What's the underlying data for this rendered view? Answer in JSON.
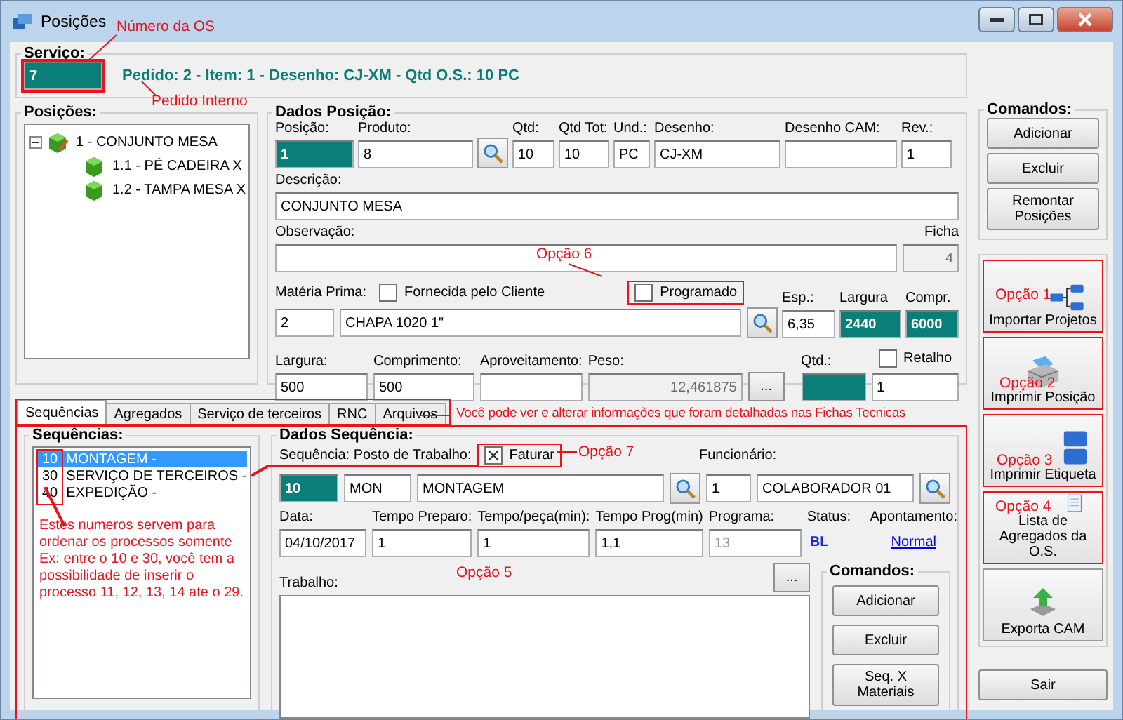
{
  "window": {
    "title": "Posições"
  },
  "servico": {
    "label": "Serviço:",
    "value": "7",
    "highlighted": true,
    "info": "Pedido: 2 - Item: 1 - Desenho: CJ-XM - Qtd O.S.: 10 PC"
  },
  "posicoes": {
    "title": "Posições:",
    "tree": [
      {
        "label": "1 - CONJUNTO MESA",
        "expanded": true,
        "children": [
          {
            "label": "1.1 - PÉ CADEIRA X"
          },
          {
            "label": "1.2 - TAMPA MESA X"
          }
        ]
      }
    ]
  },
  "dados_posicao": {
    "title": "Dados Posição:",
    "posicao": {
      "label": "Posição:",
      "value": "1"
    },
    "produto": {
      "label": "Produto:",
      "value": "8"
    },
    "qtd": {
      "label": "Qtd:",
      "value": "10"
    },
    "qtd_tot": {
      "label": "Qtd Tot:",
      "value": "10"
    },
    "und": {
      "label": "Und.:",
      "value": "PC"
    },
    "desenho": {
      "label": "Desenho:",
      "value": "CJ-XM"
    },
    "desenho_cam": {
      "label": "Desenho CAM:"
    },
    "rev": {
      "label": "Rev.:",
      "value": "1"
    },
    "descricao": {
      "label": "Descrição:",
      "value": "CONJUNTO MESA"
    },
    "observacao": {
      "label": "Observação:"
    },
    "ficha": {
      "label": "Ficha",
      "value": "4"
    },
    "materia_prima": {
      "label": "Matéria Prima:",
      "code": "2",
      "name": "CHAPA 1020 1\""
    },
    "fornecida": {
      "label": "Fornecida pelo Cliente",
      "checked": false
    },
    "programado": {
      "label": "Programado",
      "checked": false,
      "highlighted": true
    },
    "esp": {
      "label": "Esp.:",
      "value": "6,35"
    },
    "largura_mp": {
      "label": "Largura",
      "value": "2440"
    },
    "compr": {
      "label": "Compr.",
      "value": "6000"
    },
    "largura": {
      "label": "Largura:",
      "value": "500"
    },
    "comprimento": {
      "label": "Comprimento:",
      "value": "500"
    },
    "aproveitamento": {
      "label": "Aproveitamento:"
    },
    "peso": {
      "label": "Peso:",
      "value": "12,461875"
    },
    "more": "...",
    "qtd2": {
      "label": "Qtd.:"
    },
    "retalho": {
      "label": "Retalho",
      "checked": false,
      "value": "1"
    }
  },
  "tabs": [
    {
      "label": "Sequências",
      "selected": true
    },
    {
      "label": "Agregados",
      "selected": false
    },
    {
      "label": "Serviço de terceiros",
      "selected": false
    },
    {
      "label": "RNC",
      "selected": false
    },
    {
      "label": "Arquivos",
      "selected": false
    }
  ],
  "tabs_highlighted": true,
  "panel_highlighted": true,
  "sequencias": {
    "title": "Sequências:",
    "numbers_highlighted": true,
    "items": [
      {
        "num": "10",
        "name": "MONTAGEM -",
        "selected": true
      },
      {
        "num": "30",
        "name": "SERVIÇO DE TERCEIROS -",
        "selected": false
      },
      {
        "num": "40",
        "name": "EXPEDIÇÃO -",
        "selected": false
      }
    ]
  },
  "dados_sequencia": {
    "title": "Dados Sequência:",
    "seq_label": "Sequência: Posto de Trabalho:",
    "faturar": {
      "label": "Faturar",
      "checked": true,
      "highlighted": true
    },
    "seq": "10",
    "posto_code": "MON",
    "posto_name": "MONTAGEM",
    "funcionario": {
      "label": "Funcionário:",
      "code": "1",
      "name": "COLABORADOR 01"
    },
    "data": {
      "label": "Data:",
      "value": "04/10/2017"
    },
    "tempo_preparo": {
      "label": "Tempo Preparo:",
      "value": "1"
    },
    "tempo_peca": {
      "label": "Tempo/peça(min):",
      "value": "1"
    },
    "tempo_prog": {
      "label": "Tempo Prog(min)",
      "value": "1,1"
    },
    "programa": {
      "label": "Programa:",
      "value": "13",
      "disabled": true
    },
    "status": {
      "label": "Status:",
      "value": "BL"
    },
    "apontamento": {
      "label": "Apontamento:",
      "value": "Normal"
    },
    "trabalho": {
      "label": "Trabalho:"
    },
    "more": "...",
    "comandos": {
      "title": "Comandos:",
      "buttons": [
        "Adicionar",
        "Excluir",
        "Seq. X Materiais"
      ]
    }
  },
  "comandos": {
    "title": "Comandos:",
    "buttons": [
      "Adicionar",
      "Excluir",
      "Remontar Posições"
    ]
  },
  "tools": [
    {
      "label": "Importar Projetos",
      "kind": "tree",
      "highlighted": true
    },
    {
      "label": "Imprimir Posição",
      "kind": "printer",
      "highlighted": true
    },
    {
      "label": "Imprimir Etiqueta",
      "kind": "label",
      "highlighted": true
    },
    {
      "label": "Lista de Agregados da O.S.",
      "kind": "document",
      "highlighted": true
    },
    {
      "label": "Exporta CAM",
      "kind": "export",
      "highlighted": false
    }
  ],
  "sair": "Sair",
  "annotations": [
    {
      "text": "Número da OS"
    },
    {
      "text": "Pedido Interno"
    },
    {
      "text": "Opção 6"
    },
    {
      "text": "Opção 1"
    },
    {
      "text": "Opção 2"
    },
    {
      "text": "Opção 3"
    },
    {
      "text": "Opção 4"
    },
    {
      "text": "Você pode ver e alterar informações que foram detalhadas nas Fichas Tecnicas"
    },
    {
      "text": "Opção 7"
    },
    {
      "text": "Opção 5"
    },
    {
      "text": "Estes numeros servem para ordenar os processos somente Ex: entre o 10 e 30, você tem a possibilidade de inserir  o processo 11, 12, 13, 14 ate o 29."
    }
  ]
}
